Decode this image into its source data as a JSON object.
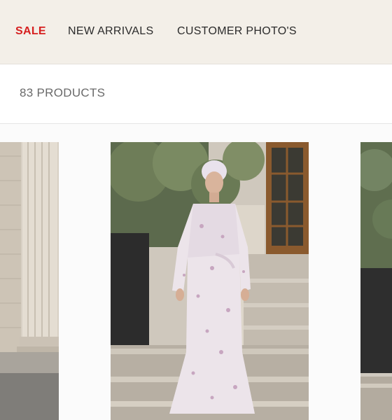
{
  "nav": {
    "sale_label": "SALE",
    "new_arrivals_label": "NEW ARRIVALS",
    "customer_photos_label": "CUSTOMER PHOTO'S"
  },
  "listing": {
    "product_count": "83 PRODUCTS"
  },
  "colors": {
    "sale_red": "#d61f1f",
    "nav_bg": "#f3efe8"
  },
  "products": [
    {
      "image": "building-columns-photo"
    },
    {
      "image": "model-floral-dress-photo"
    },
    {
      "image": "greenery-building-photo"
    }
  ]
}
